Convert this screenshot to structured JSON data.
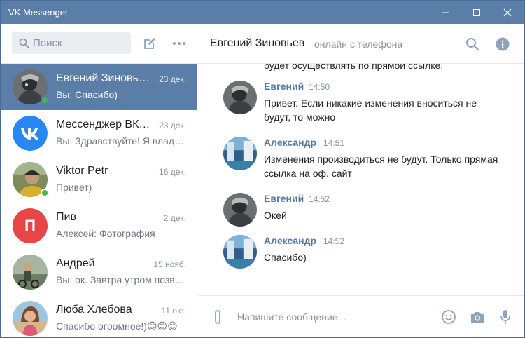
{
  "window": {
    "title": "VK Messenger"
  },
  "search": {
    "placeholder": "Поиск"
  },
  "chats": [
    {
      "name": "Евгений Зиновьев",
      "date": "23 дек.",
      "preview": "Вы: Спасибо)",
      "active": true,
      "online": true
    },
    {
      "name": "Мессенджер ВКонтакте",
      "date": "23 дек.",
      "preview": "Вы: Здравствуйте! Я владелец группы",
      "active": false,
      "online": false
    },
    {
      "name": "Viktor Petr",
      "date": "16 дек.",
      "preview": "Привет)",
      "active": false,
      "online": true
    },
    {
      "name": "Пив",
      "date": "2 дек.",
      "preview": "Алексей: Фотография",
      "active": false,
      "online": false,
      "avatar_letter": "П"
    },
    {
      "name": "Андрей",
      "date": "15 нояб.",
      "preview": "Вы: ок. Завтра утром позвоню",
      "active": false,
      "online": false
    },
    {
      "name": "Люба Хлебова",
      "date": "11 окт.",
      "preview": "Спасибо огромное!)😊😊😊",
      "active": false,
      "online": false
    }
  ],
  "header": {
    "name": "Евгений Зиновьев",
    "status": "онлайн с телефона"
  },
  "messages": {
    "cut_text": "будет осуществлять по прямой ссылке.",
    "items": [
      {
        "author": "Евгений",
        "time": "14:50",
        "text": "Привет. Если никакие изменения вноситься не будут, то можно"
      },
      {
        "author": "Александр",
        "time": "14:51",
        "text": "Изменения производиться не будут. Только прямая ссылка на оф. сайт"
      },
      {
        "author": "Евгений",
        "time": "14:52",
        "text": "Окей"
      },
      {
        "author": "Александр",
        "time": "14:52",
        "text": "Спасибо)"
      }
    ]
  },
  "composer": {
    "placeholder": "Напишите сообщение..."
  },
  "colors": {
    "titlebar": "#5b7ea8",
    "active_chat": "#5b7ea8",
    "author": "#55779e",
    "online": "#4bb34b",
    "vk_blue": "#2787f5",
    "piv_red": "#e64646"
  }
}
